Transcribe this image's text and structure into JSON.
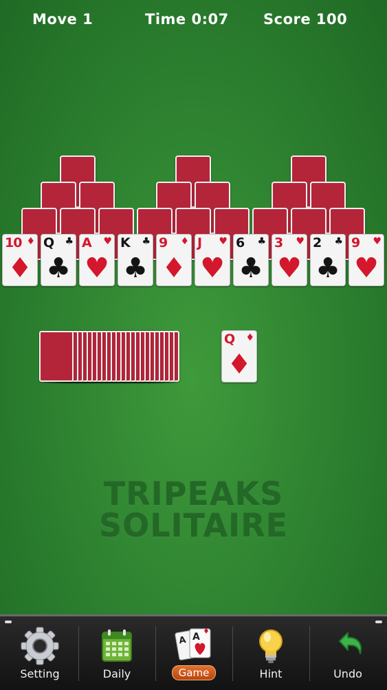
{
  "header": {
    "move": "Move 1",
    "time": "Time 0:07",
    "score": "Score 100"
  },
  "tableau_open": [
    {
      "rank": "10",
      "suit": "♦",
      "color": "red"
    },
    {
      "rank": "Q",
      "suit": "♣",
      "color": "black"
    },
    {
      "rank": "A",
      "suit": "♥",
      "color": "red"
    },
    {
      "rank": "K",
      "suit": "♣",
      "color": "black"
    },
    {
      "rank": "9",
      "suit": "♦",
      "color": "red"
    },
    {
      "rank": "J",
      "suit": "♥",
      "color": "red"
    },
    {
      "rank": "6",
      "suit": "♣",
      "color": "black"
    },
    {
      "rank": "3",
      "suit": "♥",
      "color": "red"
    },
    {
      "rank": "2",
      "suit": "♣",
      "color": "black"
    },
    {
      "rank": "9",
      "suit": "♥",
      "color": "red"
    }
  ],
  "face_down_rows": [
    3,
    6,
    9
  ],
  "stock_count": 23,
  "waste_card": {
    "rank": "Q",
    "suit": "♦",
    "color": "red"
  },
  "logo": {
    "line1": "TRIPEAKS",
    "line2": "SOLITAIRE"
  },
  "nav": {
    "setting": "Setting",
    "daily": "Daily",
    "game": "Game",
    "hint": "Hint",
    "undo": "Undo",
    "game_card1_rank": "A",
    "game_card2_rank": "A"
  },
  "colors": {
    "felt": "#2f8431",
    "card_back": "#b5253a",
    "red_suit": "#d3172c",
    "accent": "#e2702a"
  }
}
